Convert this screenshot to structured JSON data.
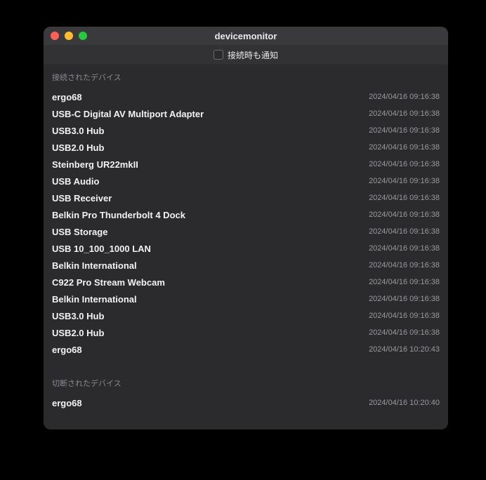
{
  "window": {
    "title": "devicemonitor"
  },
  "toolbar": {
    "notify_label": "接続時も通知",
    "notify_checked": false
  },
  "sections": {
    "connected": {
      "header": "接続されたデバイス",
      "rows": [
        {
          "name": "ergo68",
          "ts": "2024/04/16 09:16:38"
        },
        {
          "name": "USB-C Digital AV Multiport Adapter",
          "ts": "2024/04/16 09:16:38"
        },
        {
          "name": "USB3.0 Hub",
          "ts": "2024/04/16 09:16:38"
        },
        {
          "name": "USB2.0 Hub",
          "ts": "2024/04/16 09:16:38"
        },
        {
          "name": "Steinberg UR22mkII",
          "ts": "2024/04/16 09:16:38"
        },
        {
          "name": "USB Audio",
          "ts": "2024/04/16 09:16:38"
        },
        {
          "name": "USB Receiver",
          "ts": "2024/04/16 09:16:38"
        },
        {
          "name": "Belkin Pro Thunderbolt 4 Dock",
          "ts": "2024/04/16 09:16:38"
        },
        {
          "name": "USB Storage",
          "ts": "2024/04/16 09:16:38"
        },
        {
          "name": "USB 10_100_1000 LAN",
          "ts": "2024/04/16 09:16:38"
        },
        {
          "name": "Belkin International",
          "ts": "2024/04/16 09:16:38"
        },
        {
          "name": "C922 Pro Stream Webcam",
          "ts": "2024/04/16 09:16:38"
        },
        {
          "name": "Belkin International",
          "ts": "2024/04/16 09:16:38"
        },
        {
          "name": "USB3.0 Hub",
          "ts": "2024/04/16 09:16:38"
        },
        {
          "name": "USB2.0 Hub",
          "ts": "2024/04/16 09:16:38"
        },
        {
          "name": "ergo68",
          "ts": "2024/04/16 10:20:43"
        }
      ]
    },
    "disconnected": {
      "header": "切断されたデバイス",
      "rows": [
        {
          "name": "ergo68",
          "ts": "2024/04/16 10:20:40"
        }
      ]
    }
  }
}
